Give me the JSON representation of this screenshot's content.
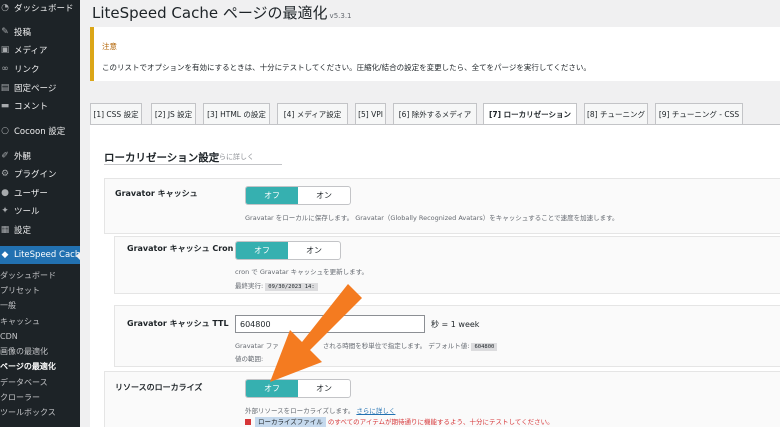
{
  "sidebar": {
    "items": [
      {
        "label": "ダッシュボード",
        "icon": "dashboard-icon",
        "glyph": "◔"
      },
      {
        "label": "投稿",
        "icon": "pin-icon",
        "glyph": "✎"
      },
      {
        "label": "メディア",
        "icon": "media-icon",
        "glyph": "▣"
      },
      {
        "label": "リンク",
        "icon": "link-icon",
        "glyph": "∞"
      },
      {
        "label": "固定ページ",
        "icon": "page-icon",
        "glyph": "▤"
      },
      {
        "label": "コメント",
        "icon": "comment-icon",
        "glyph": "▬"
      },
      {
        "label": "Cocoon 設定",
        "icon": "cocoon-icon",
        "glyph": "○"
      },
      {
        "label": "外観",
        "icon": "brush-icon",
        "glyph": "✐"
      },
      {
        "label": "プラグイン",
        "icon": "plugin-icon",
        "glyph": "⚙"
      },
      {
        "label": "ユーザー",
        "icon": "user-icon",
        "glyph": "●"
      },
      {
        "label": "ツール",
        "icon": "wrench-icon",
        "glyph": "✦"
      },
      {
        "label": "設定",
        "icon": "settings-icon",
        "glyph": "▦"
      },
      {
        "label": "LiteSpeed Cache",
        "icon": "litespeed-icon",
        "glyph": "◆"
      }
    ],
    "sub_items": [
      "ダッシュボード",
      "プリセット",
      "一般",
      "キャッシュ",
      "CDN",
      "画像の最適化",
      "ページの最適化",
      "データベース",
      "クローラー",
      "ツールボックス"
    ]
  },
  "header": {
    "title": "LiteSpeed Cache ページの最適化",
    "version": "v5.3.1"
  },
  "notice": {
    "title": "注意",
    "text": "このリストでオプションを有効にするときは、十分にテストしてください。圧縮化/結合の設定を変更したら、全てをパージを実行してください。"
  },
  "tabs": [
    "[1] CSS 設定",
    "[2] JS 設定",
    "[3] HTML の設定",
    "[4] メディア設定",
    "[5] VPI",
    "[6] 除外するメディア",
    "[7] ローカリゼーション",
    "[8] チューニング",
    "[9] チューニング - CSS"
  ],
  "section": {
    "title": "ローカリゼーション設定",
    "more": "さらに詳しく"
  },
  "settings": {
    "gravatar": {
      "label": "Gravator キャッシュ",
      "on": "オフ",
      "off": "オン",
      "desc": "Gravatar をローカルに保存します。 Gravatar（Globally Recognized Avatars）をキャッシュすることで速度を加速します。"
    },
    "gravatar_cron": {
      "label": "Gravator キャッシュ Cron",
      "on": "オフ",
      "off": "オン",
      "desc": "cron で Gravatar キャッシュを更新します。",
      "last_run_label": "最終実行:",
      "last_run_value": "09/30/2023 14:"
    },
    "gravatar_ttl": {
      "label": "Gravator キャッシュ TTL",
      "value": "604800",
      "suffix": "秒 = 1 week",
      "desc_a": "Gravatar ファ",
      "desc_b": "される時間を秒単位で指定します。 デフォルト値:",
      "default_value": "604800",
      "range_label": "値の範囲:"
    },
    "localize": {
      "label": "リソースのローカライズ",
      "on": "オフ",
      "off": "オン",
      "desc": "外部リソースをローカライズします。",
      "desc_link": "さらに詳しく",
      "warn_tag": "ローカライズファイル",
      "warn_text": "のすべてのアイテムが期待通りに機能するよう、十分にテストしてください。"
    }
  },
  "colors": {
    "toggle_active": "#36b0b0",
    "sidebar_bg": "#1d2327",
    "sidebar_active": "#2271b1",
    "arrow": "#f47b20"
  }
}
